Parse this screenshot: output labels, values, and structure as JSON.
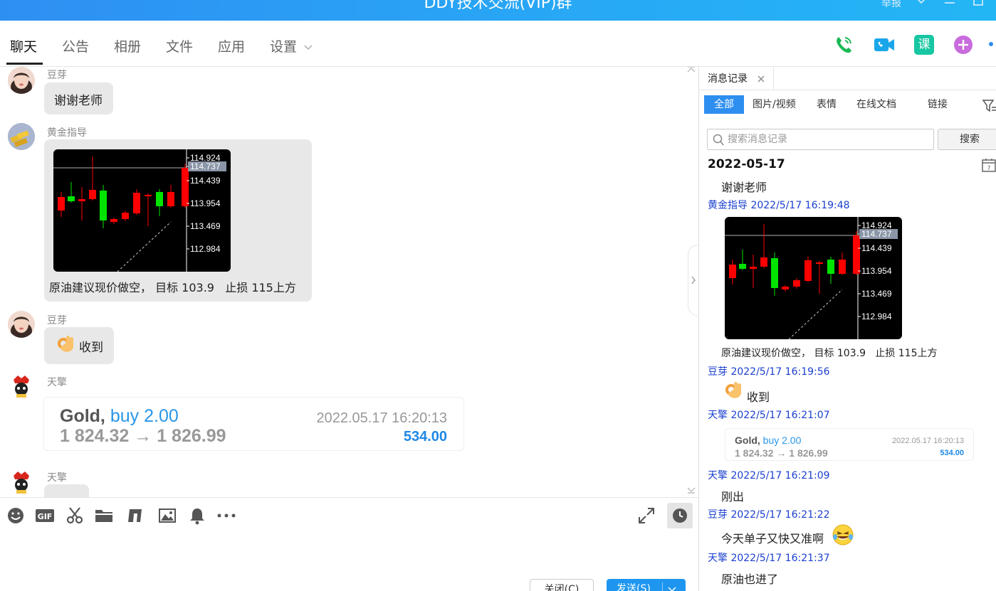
{
  "window": {
    "title": "DDY技术交流(VIP)群",
    "report_label": "举报"
  },
  "tabs": [
    {
      "label": "聊天"
    },
    {
      "label": "公告"
    },
    {
      "label": "相册"
    },
    {
      "label": "文件"
    },
    {
      "label": "应用"
    },
    {
      "label": "设置"
    }
  ],
  "top_icons": [
    {
      "icon": "voice-call-icon",
      "color": "#19b955"
    },
    {
      "icon": "video-call-icon",
      "color": "#1aa6ea"
    },
    {
      "icon": "class-icon",
      "label": "课",
      "color": "#17c6a2"
    },
    {
      "icon": "add-app-icon",
      "color": "#c86bdc"
    }
  ],
  "chart": {
    "price_labels": [
      "114.924",
      "114.737",
      "114.439",
      "113.954",
      "113.469",
      "112.984"
    ],
    "current_price": "114.737",
    "colors": {
      "up": "#00e400",
      "down": "#ff0000",
      "bg": "#000000"
    }
  },
  "messages": [
    {
      "sender": "豆芽",
      "text": "谢谢老师"
    },
    {
      "sender": "黄金指导",
      "caption": "原油建议现价做空， 目标 103.9   止损 115上方"
    },
    {
      "sender": "豆芽",
      "text": "收到"
    },
    {
      "sender": "天擎",
      "trade": {
        "symbol": "Gold,",
        "side": "buy 2.00",
        "prices": "1 824.32 → 1 826.99",
        "time": "2022.05.17 16:20:13",
        "profit": "534.00"
      }
    },
    {
      "sender": "天擎"
    }
  ],
  "composer": {
    "close_label": "关闭(C)",
    "send_label": "发送(S)"
  },
  "panel": {
    "tab_label": "消息记录",
    "filters": [
      "全部",
      "图片/视频",
      "表情",
      "在线文档",
      "链接"
    ],
    "search_placeholder": "搜索消息记录",
    "search_button": "搜索",
    "date": "2022-05-17",
    "records": [
      {
        "text": "谢谢老师"
      },
      {
        "meta": "黄金指导 2022/5/17 16:19:48"
      },
      {
        "caption": "原油建议现价做空， 目标 103.9   止损 115上方"
      },
      {
        "meta": "豆芽 2022/5/17 16:19:56"
      },
      {
        "text": "收到"
      },
      {
        "meta": "天擎 2022/5/17 16:21:07"
      },
      {
        "meta": "天擎 2022/5/17 16:21:09"
      },
      {
        "text": "刚出"
      },
      {
        "meta": "豆芽 2022/5/17 16:21:22"
      },
      {
        "text": "今天单子又快又准啊"
      },
      {
        "meta": "天擎 2022/5/17 16:21:37"
      },
      {
        "text": "原油也进了"
      }
    ]
  }
}
